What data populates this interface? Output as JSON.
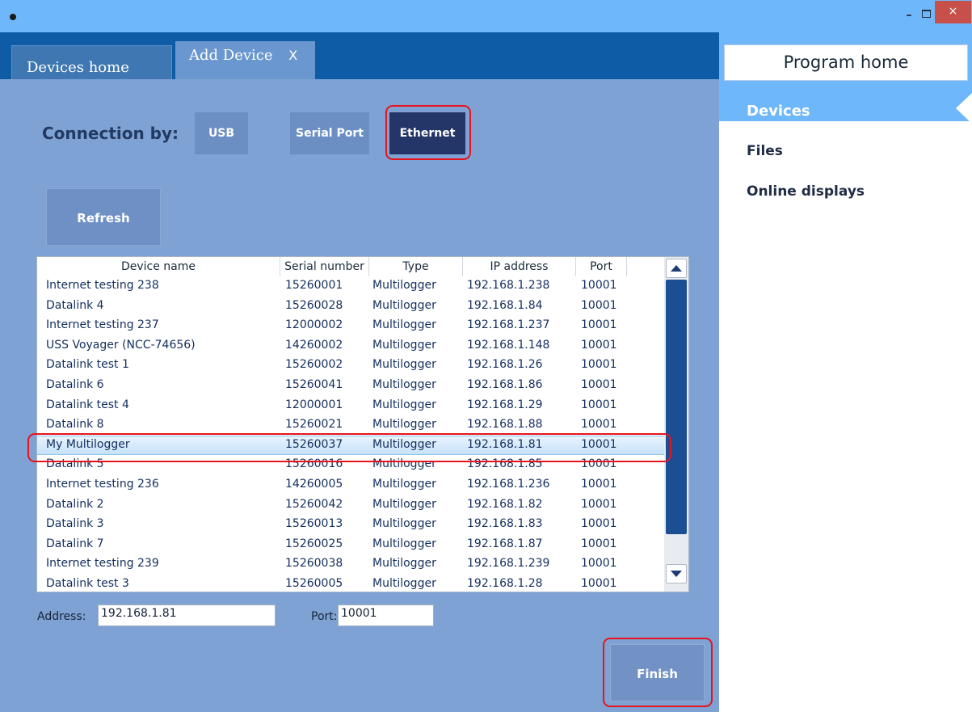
{
  "tabs": {
    "devices_home": "Devices home",
    "add_device": "Add Device",
    "add_device_close": "X"
  },
  "window": {
    "minimize": "–",
    "close": "×"
  },
  "connection": {
    "label": "Connection by:",
    "options": [
      "USB",
      "Serial Port",
      "Ethernet"
    ],
    "selected": "Ethernet"
  },
  "refresh_label": "Refresh",
  "table": {
    "columns": [
      "Device name",
      "Serial number",
      "Type",
      "IP address",
      "Port"
    ],
    "rows": [
      [
        "Internet testing 238",
        "15260001",
        "Multilogger",
        "192.168.1.238",
        "10001"
      ],
      [
        "Datalink 4",
        "15260028",
        "Multilogger",
        "192.168.1.84",
        "10001"
      ],
      [
        "Internet testing 237",
        "12000002",
        "Multilogger",
        "192.168.1.237",
        "10001"
      ],
      [
        "USS Voyager (NCC-74656)",
        "14260002",
        "Multilogger",
        "192.168.1.148",
        "10001"
      ],
      [
        "Datalink test 1",
        "15260002",
        "Multilogger",
        "192.168.1.26",
        "10001"
      ],
      [
        "Datalink 6",
        "15260041",
        "Multilogger",
        "192.168.1.86",
        "10001"
      ],
      [
        "Datalink test 4",
        "12000001",
        "Multilogger",
        "192.168.1.29",
        "10001"
      ],
      [
        "Datalink 8",
        "15260021",
        "Multilogger",
        "192.168.1.88",
        "10001"
      ],
      [
        "My Multilogger",
        "15260037",
        "Multilogger",
        "192.168.1.81",
        "10001"
      ],
      [
        "Datalink 5",
        "15260016",
        "Multilogger",
        "192.168.1.85",
        "10001"
      ],
      [
        "Internet testing 236",
        "14260005",
        "Multilogger",
        "192.168.1.236",
        "10001"
      ],
      [
        "Datalink 2",
        "15260042",
        "Multilogger",
        "192.168.1.82",
        "10001"
      ],
      [
        "Datalink 3",
        "15260013",
        "Multilogger",
        "192.168.1.83",
        "10001"
      ],
      [
        "Datalink 7",
        "15260025",
        "Multilogger",
        "192.168.1.87",
        "10001"
      ],
      [
        "Internet testing 239",
        "15260038",
        "Multilogger",
        "192.168.1.239",
        "10001"
      ],
      [
        "Datalink test 3",
        "15260005",
        "Multilogger",
        "192.168.1.28",
        "10001"
      ]
    ],
    "selected_row": 8
  },
  "address": {
    "label": "Address:",
    "value": "192.168.1.81"
  },
  "port": {
    "label": "Port:",
    "value": "10001"
  },
  "finish_label": "Finish",
  "sidebar": {
    "program_home": "Program home",
    "items": [
      "Devices",
      "Files",
      "Online displays"
    ],
    "active": "Devices"
  },
  "colors": {
    "titlebar": "#6fb7fb",
    "tabstrip": "#0f5ca6",
    "content_bg": "#7ea2d3",
    "selected_button": "#243668",
    "highlight": "#e8131c"
  }
}
